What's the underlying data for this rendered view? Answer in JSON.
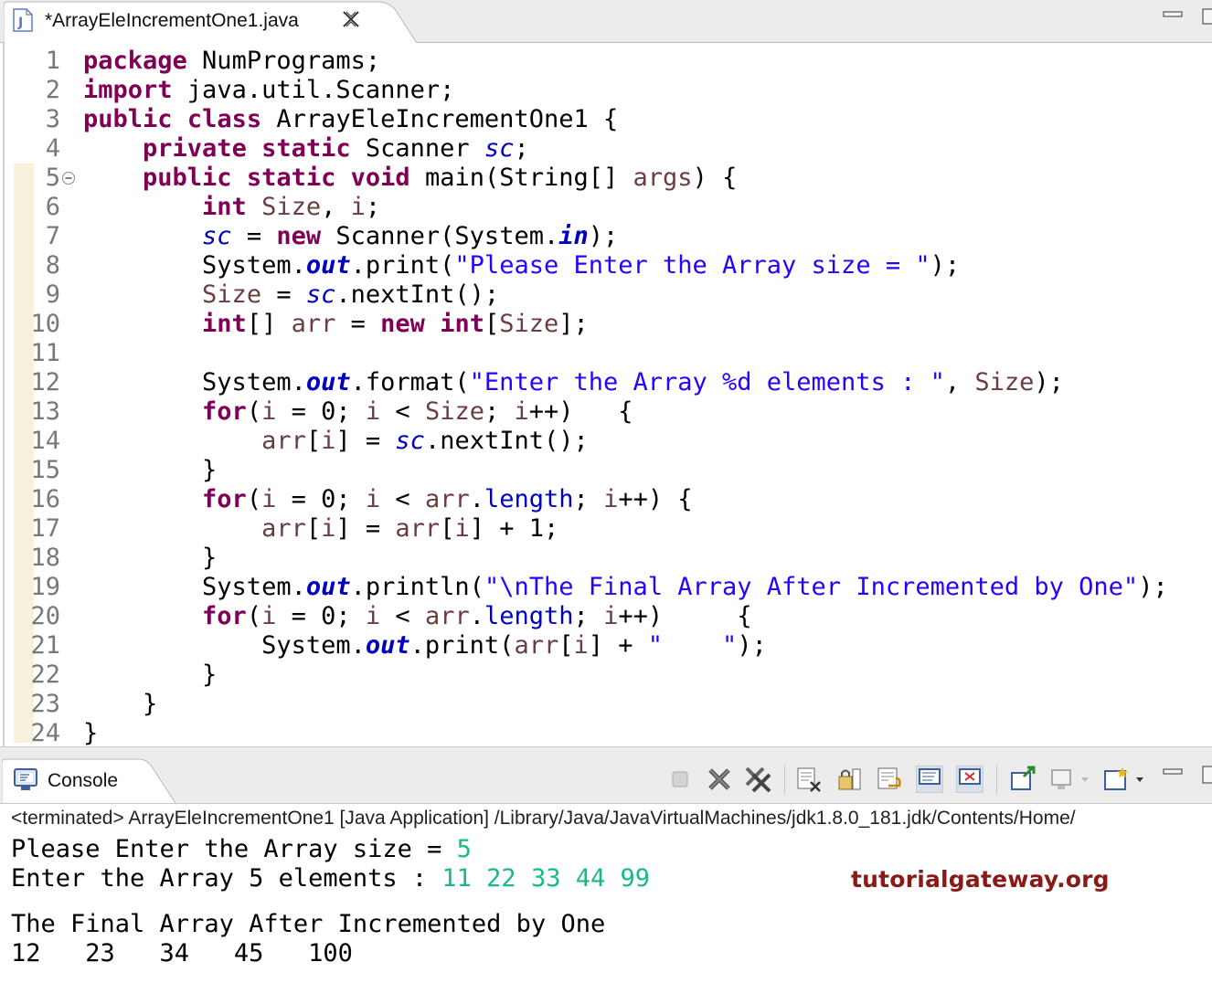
{
  "editor_tab": {
    "title": "*ArrayEleIncrementOne1.java"
  },
  "code_lines": [
    {
      "num": "1",
      "tokens": [
        {
          "t": "kw",
          "v": "package"
        },
        {
          "t": "p",
          "v": " NumPrograms;"
        }
      ]
    },
    {
      "num": "2",
      "tokens": [
        {
          "t": "kw",
          "v": "import"
        },
        {
          "t": "p",
          "v": " java.util.Scanner;"
        }
      ]
    },
    {
      "num": "3",
      "tokens": [
        {
          "t": "kw",
          "v": "public"
        },
        {
          "t": "p",
          "v": " "
        },
        {
          "t": "kw",
          "v": "class"
        },
        {
          "t": "p",
          "v": " ArrayEleIncrementOne1 {"
        }
      ]
    },
    {
      "num": "4",
      "tokens": [
        {
          "t": "p",
          "v": "    "
        },
        {
          "t": "kw",
          "v": "private"
        },
        {
          "t": "p",
          "v": " "
        },
        {
          "t": "kw",
          "v": "static"
        },
        {
          "t": "p",
          "v": " Scanner "
        },
        {
          "t": "fld",
          "v": "sc"
        },
        {
          "t": "p",
          "v": ";"
        }
      ]
    },
    {
      "num": "5",
      "tokens": [
        {
          "t": "p",
          "v": "    "
        },
        {
          "t": "kw",
          "v": "public"
        },
        {
          "t": "p",
          "v": " "
        },
        {
          "t": "kw",
          "v": "static"
        },
        {
          "t": "p",
          "v": " "
        },
        {
          "t": "kw",
          "v": "void"
        },
        {
          "t": "p",
          "v": " main(String[] "
        },
        {
          "t": "var",
          "v": "args"
        },
        {
          "t": "p",
          "v": ") {"
        }
      ]
    },
    {
      "num": "6",
      "tokens": [
        {
          "t": "p",
          "v": "        "
        },
        {
          "t": "kw",
          "v": "int"
        },
        {
          "t": "p",
          "v": " "
        },
        {
          "t": "var",
          "v": "Size"
        },
        {
          "t": "p",
          "v": ", "
        },
        {
          "t": "var",
          "v": "i"
        },
        {
          "t": "p",
          "v": ";"
        }
      ]
    },
    {
      "num": "7",
      "tokens": [
        {
          "t": "p",
          "v": "        "
        },
        {
          "t": "fld",
          "v": "sc"
        },
        {
          "t": "p",
          "v": " = "
        },
        {
          "t": "kw",
          "v": "new"
        },
        {
          "t": "p",
          "v": " Scanner(System."
        },
        {
          "t": "sfld",
          "v": "in"
        },
        {
          "t": "p",
          "v": ");"
        }
      ]
    },
    {
      "num": "8",
      "tokens": [
        {
          "t": "p",
          "v": "        System."
        },
        {
          "t": "sfld",
          "v": "out"
        },
        {
          "t": "p",
          "v": ".print("
        },
        {
          "t": "str",
          "v": "\"Please Enter the Array size = \""
        },
        {
          "t": "p",
          "v": ");"
        }
      ]
    },
    {
      "num": "9",
      "tokens": [
        {
          "t": "p",
          "v": "        "
        },
        {
          "t": "var",
          "v": "Size"
        },
        {
          "t": "p",
          "v": " = "
        },
        {
          "t": "fld",
          "v": "sc"
        },
        {
          "t": "p",
          "v": ".nextInt();"
        }
      ]
    },
    {
      "num": "10",
      "tokens": [
        {
          "t": "p",
          "v": "        "
        },
        {
          "t": "kw",
          "v": "int"
        },
        {
          "t": "p",
          "v": "[] "
        },
        {
          "t": "var",
          "v": "arr"
        },
        {
          "t": "p",
          "v": " = "
        },
        {
          "t": "kw",
          "v": "new"
        },
        {
          "t": "p",
          "v": " "
        },
        {
          "t": "kw",
          "v": "int"
        },
        {
          "t": "p",
          "v": "["
        },
        {
          "t": "var",
          "v": "Size"
        },
        {
          "t": "p",
          "v": "];"
        }
      ]
    },
    {
      "num": "11",
      "tokens": []
    },
    {
      "num": "12",
      "tokens": [
        {
          "t": "p",
          "v": "        System."
        },
        {
          "t": "sfld",
          "v": "out"
        },
        {
          "t": "p",
          "v": ".format("
        },
        {
          "t": "str",
          "v": "\"Enter the Array %d elements : \""
        },
        {
          "t": "p",
          "v": ", "
        },
        {
          "t": "var",
          "v": "Size"
        },
        {
          "t": "p",
          "v": ");"
        }
      ]
    },
    {
      "num": "13",
      "tokens": [
        {
          "t": "p",
          "v": "        "
        },
        {
          "t": "kw",
          "v": "for"
        },
        {
          "t": "p",
          "v": "("
        },
        {
          "t": "var",
          "v": "i"
        },
        {
          "t": "p",
          "v": " = 0; "
        },
        {
          "t": "var",
          "v": "i"
        },
        {
          "t": "p",
          "v": " < "
        },
        {
          "t": "var",
          "v": "Size"
        },
        {
          "t": "p",
          "v": "; "
        },
        {
          "t": "var",
          "v": "i"
        },
        {
          "t": "p",
          "v": "++)   {"
        }
      ]
    },
    {
      "num": "14",
      "tokens": [
        {
          "t": "p",
          "v": "            "
        },
        {
          "t": "var",
          "v": "arr"
        },
        {
          "t": "p",
          "v": "["
        },
        {
          "t": "var",
          "v": "i"
        },
        {
          "t": "p",
          "v": "] = "
        },
        {
          "t": "fld",
          "v": "sc"
        },
        {
          "t": "p",
          "v": ".nextInt();"
        }
      ]
    },
    {
      "num": "15",
      "tokens": [
        {
          "t": "p",
          "v": "        }"
        }
      ]
    },
    {
      "num": "16",
      "tokens": [
        {
          "t": "p",
          "v": "        "
        },
        {
          "t": "kw",
          "v": "for"
        },
        {
          "t": "p",
          "v": "("
        },
        {
          "t": "var",
          "v": "i"
        },
        {
          "t": "p",
          "v": " = 0; "
        },
        {
          "t": "var",
          "v": "i"
        },
        {
          "t": "p",
          "v": " < "
        },
        {
          "t": "var",
          "v": "arr"
        },
        {
          "t": "p",
          "v": "."
        },
        {
          "t": "mfld",
          "v": "length"
        },
        {
          "t": "p",
          "v": "; "
        },
        {
          "t": "var",
          "v": "i"
        },
        {
          "t": "p",
          "v": "++) {"
        }
      ]
    },
    {
      "num": "17",
      "tokens": [
        {
          "t": "p",
          "v": "            "
        },
        {
          "t": "var",
          "v": "arr"
        },
        {
          "t": "p",
          "v": "["
        },
        {
          "t": "var",
          "v": "i"
        },
        {
          "t": "p",
          "v": "] = "
        },
        {
          "t": "var",
          "v": "arr"
        },
        {
          "t": "p",
          "v": "["
        },
        {
          "t": "var",
          "v": "i"
        },
        {
          "t": "p",
          "v": "] + 1;"
        }
      ]
    },
    {
      "num": "18",
      "tokens": [
        {
          "t": "p",
          "v": "        }"
        }
      ]
    },
    {
      "num": "19",
      "tokens": [
        {
          "t": "p",
          "v": "        System."
        },
        {
          "t": "sfld",
          "v": "out"
        },
        {
          "t": "p",
          "v": ".println("
        },
        {
          "t": "str",
          "v": "\"\\nThe Final Array After Incremented by One\""
        },
        {
          "t": "p",
          "v": ");"
        }
      ]
    },
    {
      "num": "20",
      "tokens": [
        {
          "t": "p",
          "v": "        "
        },
        {
          "t": "kw",
          "v": "for"
        },
        {
          "t": "p",
          "v": "("
        },
        {
          "t": "var",
          "v": "i"
        },
        {
          "t": "p",
          "v": " = 0; "
        },
        {
          "t": "var",
          "v": "i"
        },
        {
          "t": "p",
          "v": " < "
        },
        {
          "t": "var",
          "v": "arr"
        },
        {
          "t": "p",
          "v": "."
        },
        {
          "t": "mfld",
          "v": "length"
        },
        {
          "t": "p",
          "v": "; "
        },
        {
          "t": "var",
          "v": "i"
        },
        {
          "t": "p",
          "v": "++)     {"
        }
      ]
    },
    {
      "num": "21",
      "tokens": [
        {
          "t": "p",
          "v": "            System."
        },
        {
          "t": "sfld",
          "v": "out"
        },
        {
          "t": "p",
          "v": ".print("
        },
        {
          "t": "var",
          "v": "arr"
        },
        {
          "t": "p",
          "v": "["
        },
        {
          "t": "var",
          "v": "i"
        },
        {
          "t": "p",
          "v": "] + "
        },
        {
          "t": "str",
          "v": "\"    \""
        },
        {
          "t": "p",
          "v": ");"
        }
      ]
    },
    {
      "num": "22",
      "tokens": [
        {
          "t": "p",
          "v": "        }"
        }
      ]
    },
    {
      "num": "23",
      "tokens": [
        {
          "t": "p",
          "v": "    }"
        }
      ]
    },
    {
      "num": "24",
      "tokens": [
        {
          "t": "p",
          "v": "}"
        }
      ]
    }
  ],
  "console": {
    "tab_label": "Console",
    "status": "<terminated> ArrayEleIncrementOne1 [Java Application] /Library/Java/JavaVirtualMachines/jdk1.8.0_181.jdk/Contents/Home/",
    "output": [
      {
        "text": "Please Enter the Array size = ",
        "input": "5"
      },
      {
        "text": "Enter the Array 5 elements : ",
        "input": "11 22 33 44 99"
      },
      {
        "text": "",
        "input": "",
        "gap": true
      },
      {
        "text": "The Final Array After Incremented by One",
        "input": ""
      },
      {
        "text": "12   23   34   45   100",
        "input": ""
      }
    ],
    "watermark": "tutorialgateway.org"
  },
  "toolbar_icons": [
    "terminate-icon",
    "remove-launch-icon",
    "remove-all-terminated-icon",
    "clear-console-icon",
    "scroll-lock-icon",
    "word-wrap-icon",
    "show-on-stdout-icon",
    "show-on-stderr-icon",
    "pin-console-icon",
    "display-selected-console-icon",
    "open-console-icon"
  ],
  "colors": {
    "keyword": "#7f0055",
    "string": "#2a00ff",
    "local_var": "#6a3e3e",
    "field": "#0000c0",
    "console_input": "#19b88a",
    "watermark": "#8b1a17"
  }
}
